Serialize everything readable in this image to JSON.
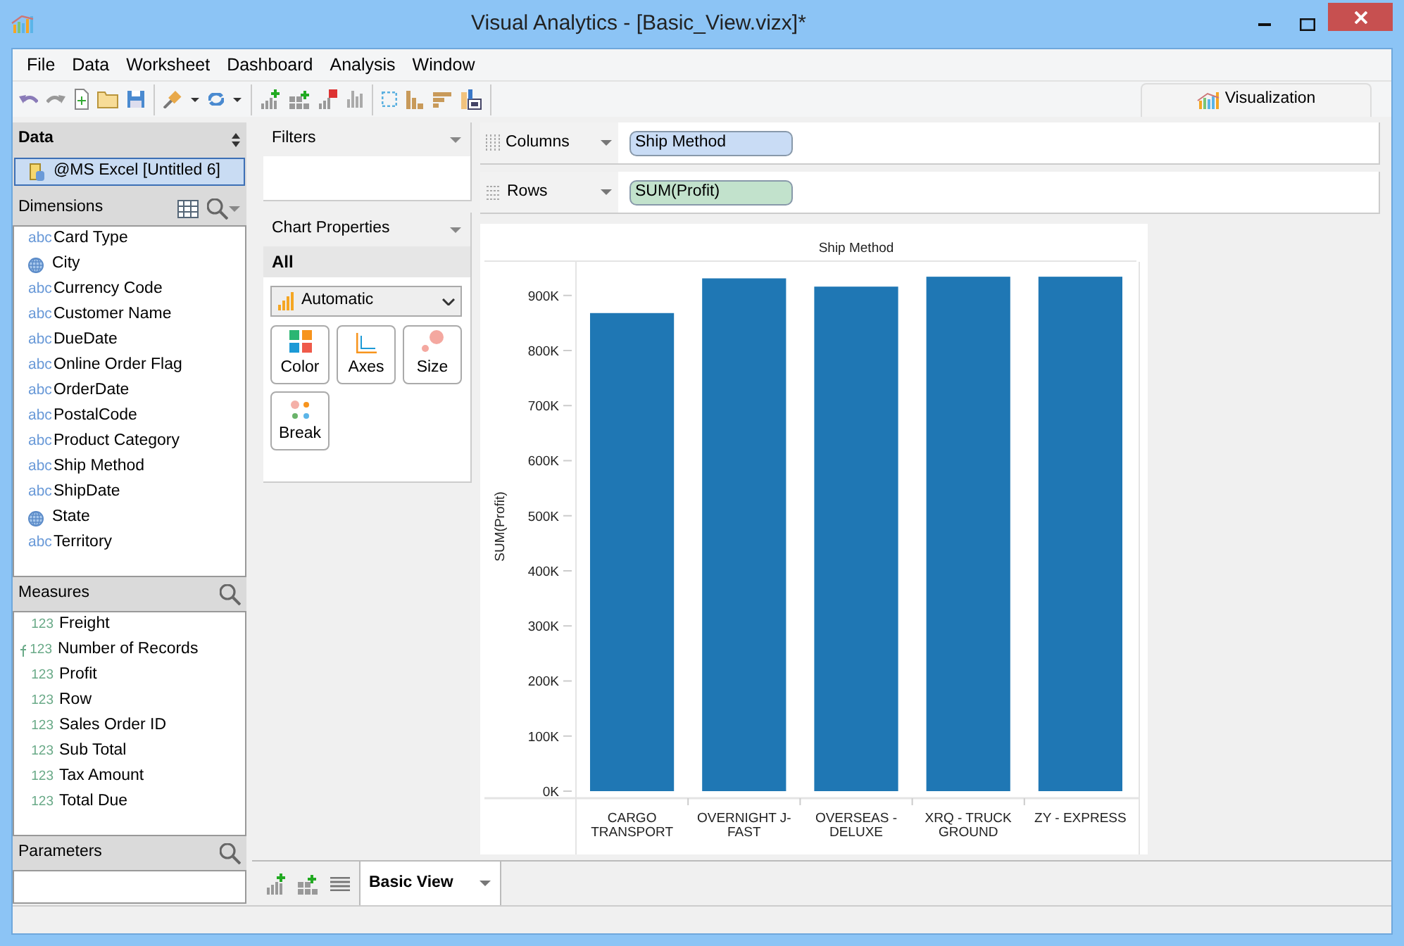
{
  "window": {
    "title": "Visual Analytics - [Basic_View.vizx]*"
  },
  "menu": [
    "File",
    "Data",
    "Worksheet",
    "Dashboard",
    "Analysis",
    "Window"
  ],
  "right_tab": {
    "label": "Visualization"
  },
  "data_panel": {
    "title": "Data",
    "source": {
      "label": "@MS Excel [Untitled 6]",
      "selected": true
    }
  },
  "dimensions": {
    "title": "Dimensions",
    "items": [
      {
        "kind": "text",
        "type_label": "abc",
        "name": "Card Type"
      },
      {
        "kind": "geo",
        "name": "City"
      },
      {
        "kind": "text",
        "type_label": "abc",
        "name": "Currency Code"
      },
      {
        "kind": "text",
        "type_label": "abc",
        "name": "Customer Name"
      },
      {
        "kind": "text",
        "type_label": "abc",
        "name": "DueDate"
      },
      {
        "kind": "text",
        "type_label": "abc",
        "name": "Online Order Flag"
      },
      {
        "kind": "text",
        "type_label": "abc",
        "name": "OrderDate"
      },
      {
        "kind": "text",
        "type_label": "abc",
        "name": "PostalCode"
      },
      {
        "kind": "text",
        "type_label": "abc",
        "name": "Product Category"
      },
      {
        "kind": "text",
        "type_label": "abc",
        "name": "Ship Method"
      },
      {
        "kind": "text",
        "type_label": "abc",
        "name": "ShipDate"
      },
      {
        "kind": "geo",
        "name": "State"
      },
      {
        "kind": "text",
        "type_label": "abc",
        "name": "Territory"
      }
    ]
  },
  "measures": {
    "title": "Measures",
    "items": [
      {
        "kind": "number",
        "type_label": "123",
        "name": "Freight"
      },
      {
        "kind": "calculated",
        "type_label": "123",
        "name": "Number of Records"
      },
      {
        "kind": "number",
        "type_label": "123",
        "name": "Profit"
      },
      {
        "kind": "number",
        "type_label": "123",
        "name": "Row"
      },
      {
        "kind": "number",
        "type_label": "123",
        "name": "Sales Order ID"
      },
      {
        "kind": "number",
        "type_label": "123",
        "name": "Sub Total"
      },
      {
        "kind": "number",
        "type_label": "123",
        "name": "Tax Amount"
      },
      {
        "kind": "number",
        "type_label": "123",
        "name": "Total Due"
      }
    ]
  },
  "parameters": {
    "title": "Parameters"
  },
  "filters": {
    "title": "Filters"
  },
  "chart_properties": {
    "title": "Chart Properties",
    "scope": "All",
    "chart_type": "Automatic",
    "buttons": [
      {
        "kind": "color",
        "label": "Color"
      },
      {
        "kind": "axes",
        "label": "Axes"
      },
      {
        "kind": "size",
        "label": "Size"
      },
      {
        "kind": "break",
        "label": "Break"
      }
    ]
  },
  "shelves": [
    {
      "kind": "columns",
      "label": "Columns",
      "pill": "Ship Method",
      "color": "#c9dcf5"
    },
    {
      "kind": "rows",
      "label": "Rows",
      "pill": "SUM(Profit)",
      "color": "#c2e2cc"
    }
  ],
  "chart": {
    "chart_data": {
      "type": "bar",
      "title": "Ship Method",
      "ylabel": "SUM(Profit)",
      "categories": [
        "CARGO\nTRANSPORT",
        "OVERNIGHT J-\nFAST",
        "OVERSEAS -\nDELUXE",
        "XRQ - TRUCK\nGROUND",
        "ZY - EXPRESS"
      ],
      "series": [
        {
          "color": "#1f77b4",
          "values": [
            868000,
            931000,
            916000,
            934000,
            934000
          ]
        }
      ],
      "ylim": [
        0,
        961000
      ],
      "yticks": [
        {
          "value": 0,
          "label": "0K"
        },
        {
          "value": 100000,
          "label": "100K"
        },
        {
          "value": 200000,
          "label": "200K"
        },
        {
          "value": 300000,
          "label": "300K"
        },
        {
          "value": 400000,
          "label": "400K"
        },
        {
          "value": 500000,
          "label": "500K"
        },
        {
          "value": 600000,
          "label": "600K"
        },
        {
          "value": 700000,
          "label": "700K"
        },
        {
          "value": 800000,
          "label": "800K"
        },
        {
          "value": 900000,
          "label": "900K"
        }
      ]
    }
  },
  "sheet_tabs": [
    {
      "label": "Basic View",
      "selected": true
    }
  ]
}
